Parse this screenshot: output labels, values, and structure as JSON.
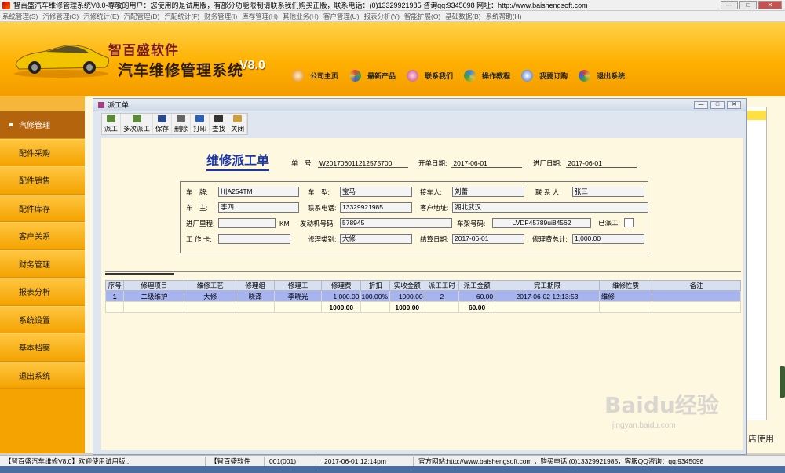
{
  "window": {
    "title": "智百盛汽车维修管理系统V8.0-尊敬的用户：您使用的是试用版，有部分功能限制请联系我们购买正版，联系电话：(0)13329921985 咨询qq:9345098   网址：http://www.baishengsoft.com",
    "controls": [
      "—",
      "□",
      "✕"
    ]
  },
  "menu": [
    "系统管理(S)",
    "汽修管理(C)",
    "汽修统计(E)",
    "汽配管理(D)",
    "汽配统计(F)",
    "财务管理(I)",
    "库存管理(H)",
    "其他业务(H)",
    "客户管理(U)",
    "报表分析(Y)",
    "智能扩展(O)",
    "基础数据(B)",
    "系统帮助(H)"
  ],
  "banner": {
    "brand_top": "智百盛软件",
    "brand_main": "汽车维修管理系统",
    "version": "V8.0",
    "nav": [
      {
        "label": "公司主页",
        "icon": "home-icon",
        "color": "#e08030"
      },
      {
        "label": "最新产品",
        "icon": "products-icon",
        "color": "#60a040"
      },
      {
        "label": "联系我们",
        "icon": "contact-icon",
        "color": "#c04080"
      },
      {
        "label": "操作教程",
        "icon": "tutorial-icon",
        "color": "#4080d0"
      },
      {
        "label": "我要订购",
        "icon": "order-icon",
        "color": "#3060c0"
      },
      {
        "label": "退出系统",
        "icon": "exit-icon",
        "color": "#d04040"
      }
    ]
  },
  "sidebar": [
    {
      "label": "汽修管理",
      "active": true
    },
    {
      "label": "配件采购"
    },
    {
      "label": "配件销售"
    },
    {
      "label": "配件库存"
    },
    {
      "label": "客户关系"
    },
    {
      "label": "财务管理"
    },
    {
      "label": "报表分析"
    },
    {
      "label": "系统设置"
    },
    {
      "label": "基本档案"
    },
    {
      "label": "退出系统"
    }
  ],
  "dialog": {
    "title": "派工单",
    "toolbar": [
      {
        "label": "派工",
        "icon": "dispatch-icon",
        "color": "#5a8a3a"
      },
      {
        "label": "多次派工",
        "icon": "multi-dispatch-icon",
        "color": "#5a8a3a"
      },
      {
        "label": "保存",
        "icon": "save-icon",
        "color": "#2a4a8a"
      },
      {
        "label": "删除",
        "icon": "delete-icon",
        "color": "#666666"
      },
      {
        "label": "打印",
        "icon": "print-icon",
        "color": "#3060b0"
      },
      {
        "label": "查找",
        "icon": "find-icon",
        "color": "#333333"
      },
      {
        "label": "关闭",
        "icon": "close-icon",
        "color": "#c8a040"
      }
    ],
    "order_title": "维修派工单",
    "header": {
      "order_no_label": "单　号:",
      "order_no": "W201706011212575700",
      "open_date_label": "开单日期:",
      "open_date": "2017-06-01",
      "entry_date_label": "进厂日期:",
      "entry_date": "2017-06-01"
    },
    "form": {
      "plate_label": "车　牌:",
      "plate": "川A254TM",
      "model_label": "车　型:",
      "model": "宝马",
      "receiver_label": "接车人:",
      "receiver": "刘蕾",
      "contact_label": "联 系 人:",
      "contact": "张三",
      "owner_label": "车　主:",
      "owner": "李四",
      "phone_label": "联系电话:",
      "phone": "13329921985",
      "address_label": "客户地址:",
      "address": "湖北武汉",
      "mileage_label": "进厂里程:",
      "mileage": "",
      "mileage_unit": "KM",
      "engine_label": "发动机号码:",
      "engine": "578945",
      "vin_label": "车架号码:",
      "vin": "LVDF45789ui84562",
      "dispatched_label": "已派工:",
      "card_label": "工 作 卡:",
      "card": "",
      "repair_type_label": "修理类别:",
      "repair_type": "大修",
      "settle_date_label": "结算日期:",
      "settle_date": "2017-06-01",
      "total_label": "修理费总计:",
      "total": "1,000.00"
    },
    "table": {
      "columns": [
        "序号",
        "修理项目",
        "维修工艺",
        "修理组",
        "修理工",
        "修理费",
        "折扣",
        "实收金额",
        "派工工时",
        "派工金额",
        "完工期限",
        "维修性质",
        "备注"
      ],
      "rows": [
        [
          "1",
          "二级维护",
          "大修",
          "晓泽",
          "李晓光",
          "1,000.00",
          "100.00%",
          "1000.00",
          "2",
          "60.00",
          "2017-06-02 12:13:53",
          "维修",
          ""
        ]
      ],
      "summary": {
        "fee": "1000.00",
        "received": "1000.00",
        "amount": "60.00"
      }
    }
  },
  "side_text": "店使用",
  "status": [
    "【智百盛汽车维修V8.0】欢迎使用试用版...",
    "【智百盛软件",
    "001(001)",
    "2017-06-01 12:14pm",
    "官方网站:http://www.baishengsoft.com ，购买电话:(0)13329921985，客服QQ咨询：qq:9345098"
  ],
  "watermark": {
    "text": "Baidu经验",
    "url": "jingyan.baidu.com"
  }
}
